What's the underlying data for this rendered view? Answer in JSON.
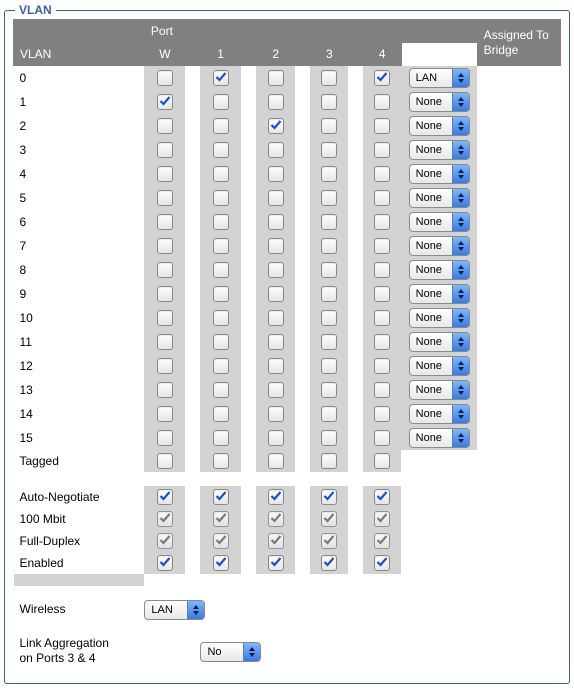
{
  "panel_title": "VLAN",
  "headers": {
    "vlan": "VLAN",
    "port": "Port",
    "ports": [
      "W",
      "1",
      "2",
      "3",
      "4"
    ],
    "assigned": "Assigned To Bridge"
  },
  "vlan_rows": [
    {
      "label": "0",
      "ports": [
        false,
        true,
        false,
        false,
        true
      ],
      "bridge": "LAN"
    },
    {
      "label": "1",
      "ports": [
        true,
        false,
        false,
        false,
        false
      ],
      "bridge": "None"
    },
    {
      "label": "2",
      "ports": [
        false,
        false,
        true,
        false,
        false
      ],
      "bridge": "None"
    },
    {
      "label": "3",
      "ports": [
        false,
        false,
        false,
        false,
        false
      ],
      "bridge": "None"
    },
    {
      "label": "4",
      "ports": [
        false,
        false,
        false,
        false,
        false
      ],
      "bridge": "None"
    },
    {
      "label": "5",
      "ports": [
        false,
        false,
        false,
        false,
        false
      ],
      "bridge": "None"
    },
    {
      "label": "6",
      "ports": [
        false,
        false,
        false,
        false,
        false
      ],
      "bridge": "None"
    },
    {
      "label": "7",
      "ports": [
        false,
        false,
        false,
        false,
        false
      ],
      "bridge": "None"
    },
    {
      "label": "8",
      "ports": [
        false,
        false,
        false,
        false,
        false
      ],
      "bridge": "None"
    },
    {
      "label": "9",
      "ports": [
        false,
        false,
        false,
        false,
        false
      ],
      "bridge": "None"
    },
    {
      "label": "10",
      "ports": [
        false,
        false,
        false,
        false,
        false
      ],
      "bridge": "None"
    },
    {
      "label": "11",
      "ports": [
        false,
        false,
        false,
        false,
        false
      ],
      "bridge": "None"
    },
    {
      "label": "12",
      "ports": [
        false,
        false,
        false,
        false,
        false
      ],
      "bridge": "None"
    },
    {
      "label": "13",
      "ports": [
        false,
        false,
        false,
        false,
        false
      ],
      "bridge": "None"
    },
    {
      "label": "14",
      "ports": [
        false,
        false,
        false,
        false,
        false
      ],
      "bridge": "None"
    },
    {
      "label": "15",
      "ports": [
        false,
        false,
        false,
        false,
        false
      ],
      "bridge": "None"
    },
    {
      "label": "Tagged",
      "ports": [
        false,
        false,
        false,
        false,
        false
      ],
      "bridge": null
    }
  ],
  "settings_rows": [
    {
      "label": "Auto-Negotiate",
      "ports": [
        true,
        true,
        true,
        true,
        true
      ],
      "checked_color": "blue",
      "disabled": false
    },
    {
      "label": "100 Mbit",
      "ports": [
        true,
        true,
        true,
        true,
        true
      ],
      "checked_color": "grey",
      "disabled": true
    },
    {
      "label": "Full-Duplex",
      "ports": [
        true,
        true,
        true,
        true,
        true
      ],
      "checked_color": "grey",
      "disabled": true
    },
    {
      "label": "Enabled",
      "ports": [
        true,
        true,
        true,
        true,
        true
      ],
      "checked_color": "blue",
      "disabled": false
    }
  ],
  "wireless": {
    "label": "Wireless",
    "value": "LAN"
  },
  "link_agg": {
    "label1": "Link Aggregation",
    "label2": "on Ports 3 & 4",
    "value": "No"
  }
}
